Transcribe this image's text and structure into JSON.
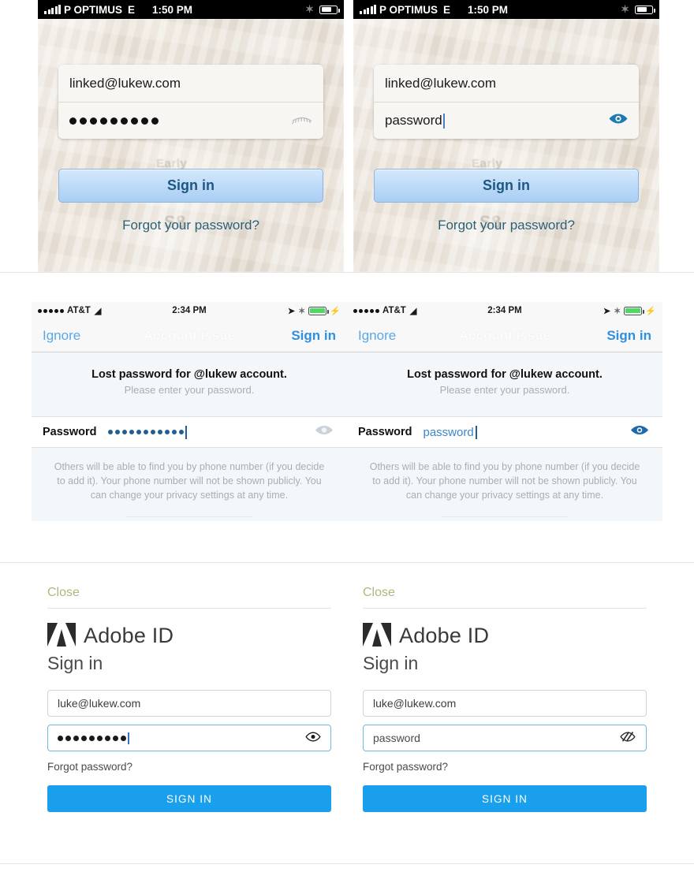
{
  "panels": {
    "linkedin_masked": {
      "status_bar": {
        "carrier": "P OPTIMUS",
        "network": "E",
        "time": "1:50 PM",
        "bluetooth_icon": "bluetooth-icon",
        "battery_icon": "battery-icon",
        "signal_icon": "signal-bars-icon"
      },
      "email_value": "linked@lukew.com",
      "password_masked": "●●●●●●●●●",
      "password_dot_count": 9,
      "reveal_icon": "eye-closed-lashes-icon",
      "signin_label": "Sign in",
      "forgot_label": "Forgot your password?",
      "bg_ghost_1": "Early",
      "bg_ghost_2": "S8"
    },
    "linkedin_revealed": {
      "status_bar": {
        "carrier": "P OPTIMUS",
        "network": "E",
        "time": "1:50 PM",
        "bluetooth_icon": "bluetooth-icon",
        "battery_icon": "battery-icon",
        "signal_icon": "signal-bars-icon"
      },
      "email_value": "linked@lukew.com",
      "password_value": "password",
      "reveal_icon": "eye-open-icon",
      "reveal_icon_color": "#1d7bb0",
      "signin_label": "Sign in",
      "forgot_label": "Forgot your password?",
      "bg_ghost_1": "Early",
      "bg_ghost_2": "S8"
    },
    "ios_masked": {
      "status_bar": {
        "carrier": "AT&T",
        "time": "2:34 PM",
        "wifi_icon": "wifi-icon",
        "location_icon": "location-arrow-icon",
        "bluetooth_icon": "bluetooth-icon",
        "battery_icon": "battery-charging-icon"
      },
      "nav_left": "Ignore",
      "nav_title": "Account issue",
      "nav_right": "Sign in",
      "message_title": "Lost password for @lukew account.",
      "message_sub": "Please enter your password.",
      "field_label": "Password",
      "password_masked": "●●●●●●●●●●●",
      "password_dot_count": 11,
      "reveal_icon": "eye-open-icon",
      "reveal_icon_color": "#c9d2da",
      "footer_text": "Others will be able to find you by phone number (if you decide to add it). Your phone number will not be shown publicly. You can change your privacy settings at any time."
    },
    "ios_revealed": {
      "status_bar": {
        "carrier": "AT&T",
        "time": "2:34 PM",
        "wifi_icon": "wifi-icon",
        "location_icon": "location-arrow-icon",
        "bluetooth_icon": "bluetooth-icon",
        "battery_icon": "battery-charging-icon"
      },
      "nav_left": "Ignore",
      "nav_title": "Account issue",
      "nav_right": "Sign in",
      "message_title": "Lost password for @lukew account.",
      "message_sub": "Please enter your password.",
      "field_label": "Password",
      "password_value": "password",
      "reveal_icon": "eye-open-icon",
      "reveal_icon_color": "#1f6aa8",
      "footer_text": "Others will be able to find you by phone number (if you decide to add it). Your phone number will not be shown publicly. You can change your privacy settings at any time."
    },
    "adobe_masked": {
      "close_label": "Close",
      "brand": "Adobe ID",
      "heading": "Sign in",
      "email_value": "luke@lukew.com",
      "password_masked": "●●●●●●●●●",
      "password_dot_count": 9,
      "reveal_icon": "eye-open-icon",
      "forgot_label": "Forgot password?",
      "signin_label": "SIGN IN",
      "accent_color": "#1a9fec",
      "close_color": "#a9b97e"
    },
    "adobe_revealed": {
      "close_label": "Close",
      "brand": "Adobe ID",
      "heading": "Sign in",
      "email_value": "luke@lukew.com",
      "password_value": "password",
      "reveal_icon": "eye-slash-icon",
      "forgot_label": "Forgot password?",
      "signin_label": "SIGN IN",
      "accent_color": "#1a9fec",
      "close_color": "#a9b97e"
    }
  }
}
